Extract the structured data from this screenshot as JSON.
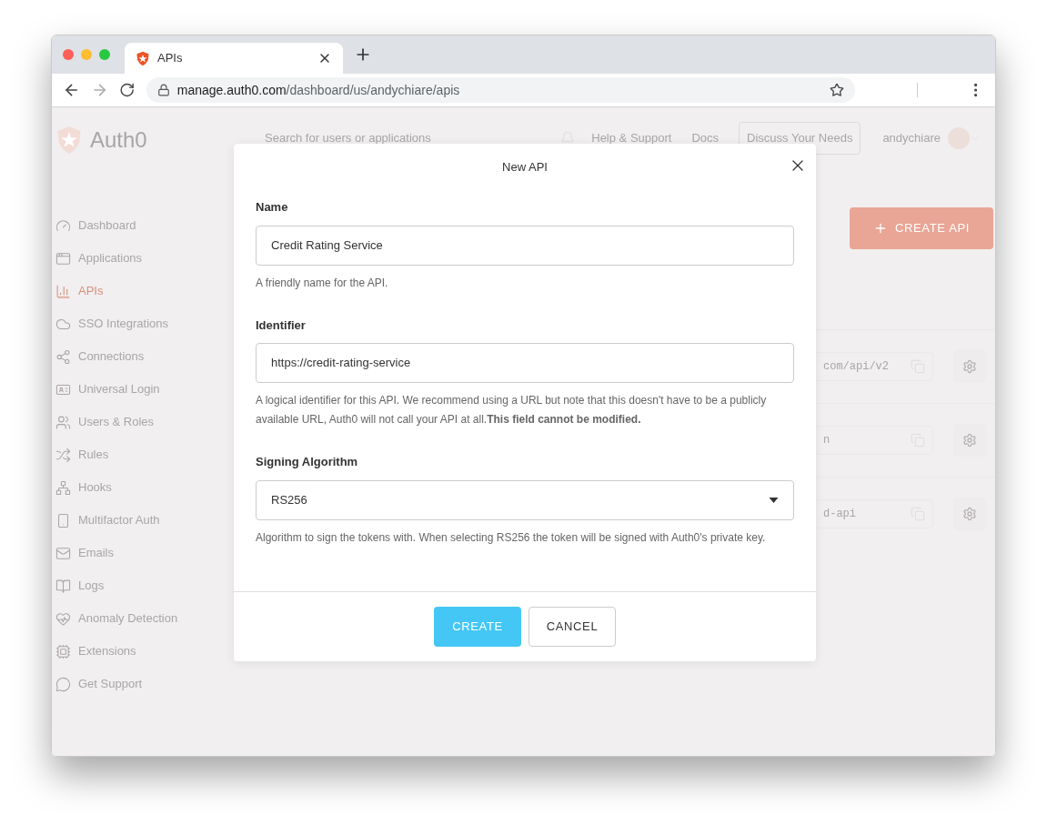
{
  "browser": {
    "tab": {
      "title": "APIs"
    },
    "url": {
      "host": "manage.auth0.com",
      "path": "/dashboard/us/andychiare/apis"
    }
  },
  "app": {
    "logo": "Auth0",
    "search": {
      "placeholder": "Search for users or applications"
    },
    "header_links": [
      "Help & Support",
      "Docs"
    ],
    "header_button": "Discuss Your Needs",
    "user": "andychiare",
    "sidebar": [
      {
        "label": "Dashboard",
        "selected": false
      },
      {
        "label": "Applications",
        "selected": false
      },
      {
        "label": "APIs",
        "selected": true
      },
      {
        "label": "SSO Integrations",
        "selected": false
      },
      {
        "label": "Connections",
        "selected": false
      },
      {
        "label": "Universal Login",
        "selected": false
      },
      {
        "label": "Users & Roles",
        "selected": false
      },
      {
        "label": "Rules",
        "selected": false
      },
      {
        "label": "Hooks",
        "selected": false
      },
      {
        "label": "Multifactor Auth",
        "selected": false
      },
      {
        "label": "Emails",
        "selected": false
      },
      {
        "label": "Logs",
        "selected": false
      },
      {
        "label": "Anomaly Detection",
        "selected": false
      },
      {
        "label": "Extensions",
        "selected": false
      },
      {
        "label": "Get Support",
        "selected": false
      }
    ],
    "create_button": "CREATE API",
    "rows": [
      {
        "identifier": "com/api/v2"
      },
      {
        "identifier": "n"
      },
      {
        "identifier": "d-api"
      }
    ]
  },
  "modal": {
    "title": "New API",
    "fields": [
      {
        "kind": "text",
        "label": "Name",
        "value": "Credit Rating Service",
        "help": "A friendly name for the API."
      },
      {
        "kind": "text",
        "label": "Identifier",
        "value": "https://credit-rating-service",
        "help": "A logical identifier for this API. We recommend using a URL but note that this doesn't have to be a publicly available URL, Auth0 will not call your API at all.**This field cannot be modified.**"
      },
      {
        "kind": "select",
        "label": "Signing Algorithm",
        "value": "RS256",
        "help": "Algorithm to sign the tokens with. When selecting RS256 the token will be signed with Auth0's private key."
      }
    ],
    "buttons": [
      {
        "kind": "primary",
        "label": "CREATE"
      },
      {
        "kind": "secondary",
        "label": "CANCEL"
      }
    ]
  }
}
